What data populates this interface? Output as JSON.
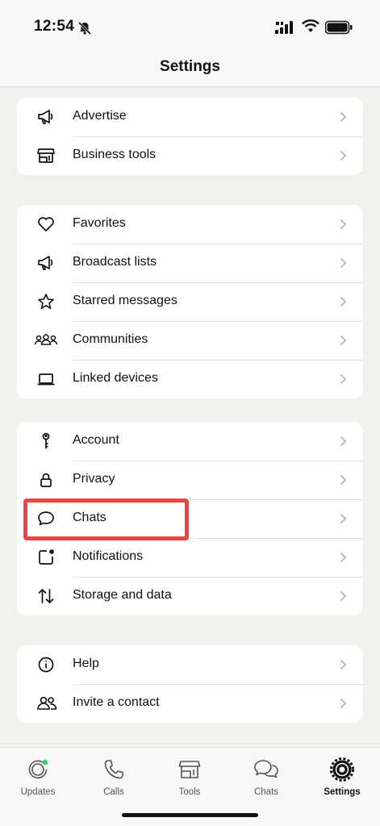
{
  "status_bar": {
    "time": "12:54"
  },
  "header": {
    "title": "Settings"
  },
  "groups": [
    {
      "items": [
        {
          "label": "Advertise",
          "icon": "megaphone-icon"
        },
        {
          "label": "Business tools",
          "icon": "storefront-icon"
        }
      ]
    },
    {
      "items": [
        {
          "label": "Favorites",
          "icon": "heart-icon"
        },
        {
          "label": "Broadcast lists",
          "icon": "megaphone-icon"
        },
        {
          "label": "Starred messages",
          "icon": "star-icon"
        },
        {
          "label": "Communities",
          "icon": "communities-icon"
        },
        {
          "label": "Linked devices",
          "icon": "laptop-icon"
        }
      ]
    },
    {
      "items": [
        {
          "label": "Account",
          "icon": "key-icon"
        },
        {
          "label": "Privacy",
          "icon": "lock-icon"
        },
        {
          "label": "Chats",
          "icon": "chat-bubble-icon"
        },
        {
          "label": "Notifications",
          "icon": "notification-icon"
        },
        {
          "label": "Storage and data",
          "icon": "up-down-arrows-icon"
        }
      ]
    },
    {
      "items": [
        {
          "label": "Help",
          "icon": "info-icon"
        },
        {
          "label": "Invite a contact",
          "icon": "people-icon"
        }
      ]
    }
  ],
  "highlight_color": "#e8473f",
  "tab_bar": {
    "tabs": [
      {
        "label": "Updates",
        "icon": "updates-icon"
      },
      {
        "label": "Calls",
        "icon": "phone-icon"
      },
      {
        "label": "Tools",
        "icon": "storefront-icon"
      },
      {
        "label": "Chats",
        "icon": "chats-icon"
      },
      {
        "label": "Settings",
        "icon": "gear-icon",
        "active": true
      }
    ]
  }
}
